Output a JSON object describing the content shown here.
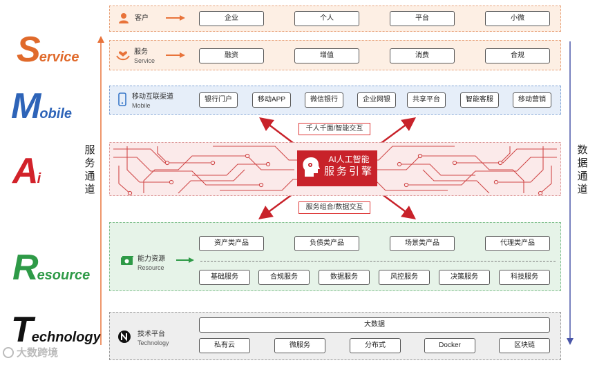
{
  "letters": [
    {
      "cap": "S",
      "rest": "ervice",
      "color": "#e06a2b"
    },
    {
      "cap": "M",
      "rest": "obile",
      "color": "#2e64b8"
    },
    {
      "cap": "A",
      "rest": "i",
      "color": "#d2222a"
    },
    {
      "cap": "R",
      "rest": "esource",
      "color": "#2e9a47"
    },
    {
      "cap": "T",
      "rest": "echnology",
      "color": "#111111"
    }
  ],
  "left_channel": "服务通道",
  "right_channel": "数据通道",
  "customer": {
    "label": "客户",
    "items": [
      "企业",
      "个人",
      "平台",
      "小微"
    ]
  },
  "service": {
    "label": "服务",
    "label_en": "Service",
    "items": [
      "融资",
      "增值",
      "消费",
      "合规"
    ]
  },
  "mobile": {
    "label": "移动互联渠道",
    "label_en": "Mobile",
    "items": [
      "银行门户",
      "移动APP",
      "微信银行",
      "企业网银",
      "共享平台",
      "智能客服",
      "移动营销"
    ]
  },
  "ai": {
    "tag_top": "千人千面/智能交互",
    "tag_bottom": "服务组合/数据交互",
    "engine_line1": "AI人工智能",
    "engine_line2": "服务引擎"
  },
  "resource": {
    "label": "能力资源",
    "label_en": "Resource",
    "products": [
      "资产类产品",
      "负债类产品",
      "场景类产品",
      "代理类产品"
    ],
    "services": [
      "基础服务",
      "合规服务",
      "数据服务",
      "风控服务",
      "决策服务",
      "科技服务"
    ]
  },
  "technology": {
    "label": "技术平台",
    "label_en": "Technology",
    "top": "大数据",
    "items": [
      "私有云",
      "微服务",
      "分布式",
      "Docker",
      "区块链"
    ]
  },
  "watermark": "大数跨境",
  "colors": {
    "orange": "#e8733a",
    "blue": "#3a78c9",
    "red": "#c8222a",
    "green": "#2e9a47",
    "gray": "#777777"
  }
}
